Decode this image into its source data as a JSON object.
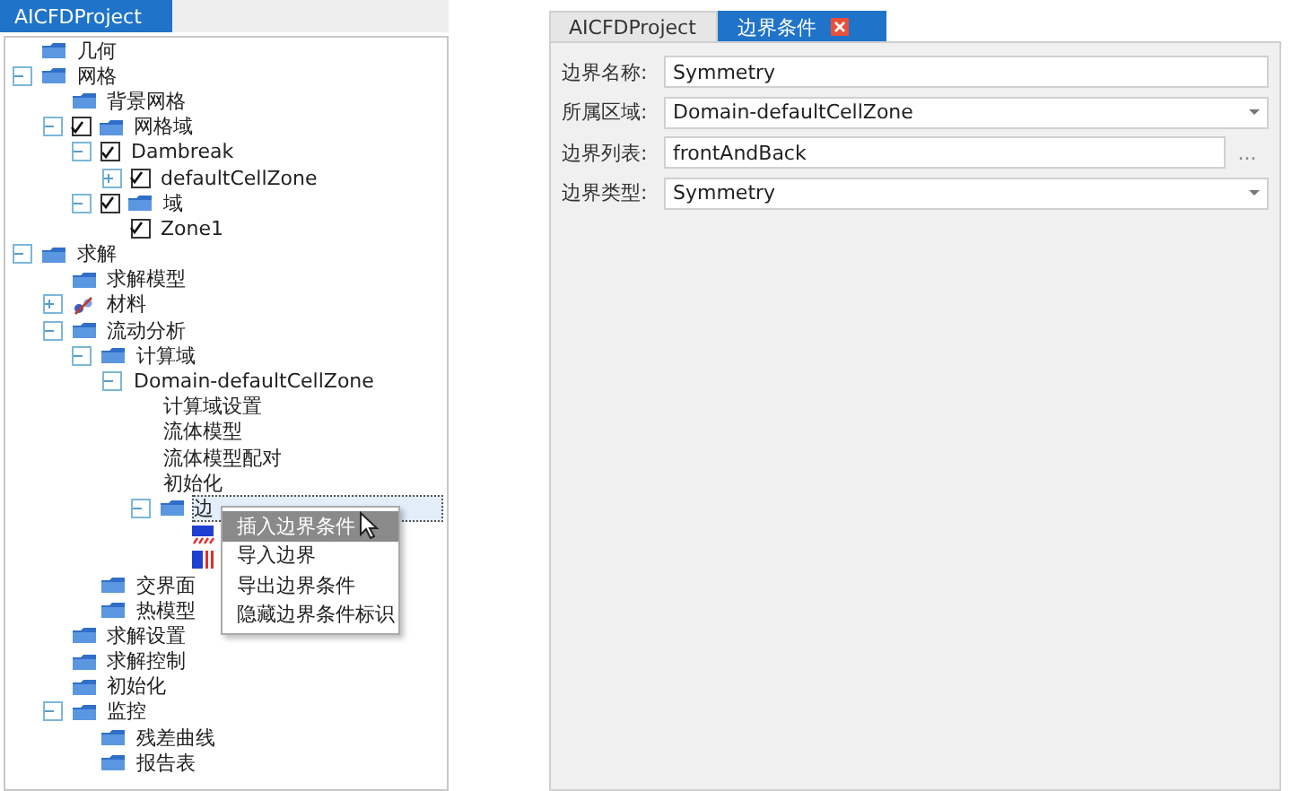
{
  "project_tab": {
    "label": "AICFDProject",
    "selected": true
  },
  "tree": [
    {
      "label": "几何",
      "kind": "folder",
      "selected": false
    },
    {
      "label": "网格",
      "kind": "folder",
      "expanded": true,
      "selected": false,
      "children": [
        {
          "label": "背景网格",
          "kind": "folder",
          "selected": false
        },
        {
          "label": "网格域",
          "kind": "folder",
          "expanded": true,
          "checked": true,
          "selected": false,
          "children": [
            {
              "label": "Dambreak",
              "expanded": true,
              "checked": true,
              "selected": false,
              "children": [
                {
                  "label": "defaultCellZone",
                  "expanded": false,
                  "checked": true,
                  "selected": false
                }
              ]
            },
            {
              "label": "域",
              "kind": "folder",
              "expanded": true,
              "checked": true,
              "selected": false,
              "children": [
                {
                  "label": "Zone1",
                  "checked": true,
                  "selected": false
                }
              ]
            }
          ]
        }
      ]
    },
    {
      "label": "求解",
      "kind": "folder",
      "expanded": true,
      "selected": false,
      "children": [
        {
          "label": "求解模型",
          "kind": "folder",
          "selected": false
        },
        {
          "label": "材料",
          "kind": "material",
          "expanded": false,
          "selected": false
        },
        {
          "label": "流动分析",
          "kind": "folder",
          "expanded": true,
          "selected": false,
          "children": [
            {
              "label": "计算域",
              "kind": "folder",
              "expanded": true,
              "selected": false,
              "children": [
                {
                  "label": "Domain-defaultCellZone",
                  "expanded": true,
                  "selected": false,
                  "children": [
                    {
                      "label": "计算域设置",
                      "selected": false
                    },
                    {
                      "label": "流体模型",
                      "selected": false
                    },
                    {
                      "label": "流体模型配对",
                      "selected": false
                    },
                    {
                      "label": "初始化",
                      "selected": false
                    },
                    {
                      "label": "边",
                      "kind": "folder",
                      "expanded": true,
                      "selected": true,
                      "children": [
                        {
                          "kind": "wall",
                          "selected": false
                        },
                        {
                          "kind": "symmetry",
                          "selected": false
                        }
                      ]
                    }
                  ]
                }
              ]
            },
            {
              "label": "交界面",
              "kind": "folder",
              "selected": false
            },
            {
              "label": "热模型",
              "kind": "folder",
              "selected": false
            }
          ]
        },
        {
          "label": "求解设置",
          "kind": "folder",
          "selected": false
        },
        {
          "label": "求解控制",
          "kind": "folder",
          "selected": false
        },
        {
          "label": "初始化",
          "kind": "folder",
          "selected": false
        },
        {
          "label": "监控",
          "kind": "folder",
          "expanded": true,
          "selected": false,
          "children": [
            {
              "label": "残差曲线",
              "kind": "folder",
              "selected": false
            },
            {
              "label": "报告表",
              "kind": "folder",
              "selected": false
            }
          ]
        }
      ]
    }
  ],
  "context_menu": [
    {
      "label": "插入边界条件",
      "selected": true
    },
    {
      "label": "导入边界",
      "selected": false
    },
    {
      "label": "导出边界条件",
      "selected": false
    },
    {
      "label": "隐藏边界条件标识",
      "selected": false
    }
  ],
  "editor_tabs": [
    {
      "label": "AICFDProject",
      "selected": false,
      "closable": false
    },
    {
      "label": "边界条件",
      "selected": true,
      "closable": true
    }
  ],
  "form": [
    {
      "label": "边界名称:",
      "kind": "text",
      "value": "Symmetry"
    },
    {
      "label": "所属区域:",
      "kind": "select",
      "value": "Domain-defaultCellZone"
    },
    {
      "label": "边界列表:",
      "kind": "picker",
      "value": "frontAndBack",
      "button": "..."
    },
    {
      "label": "边界类型:",
      "kind": "select",
      "value": "Symmetry"
    }
  ]
}
